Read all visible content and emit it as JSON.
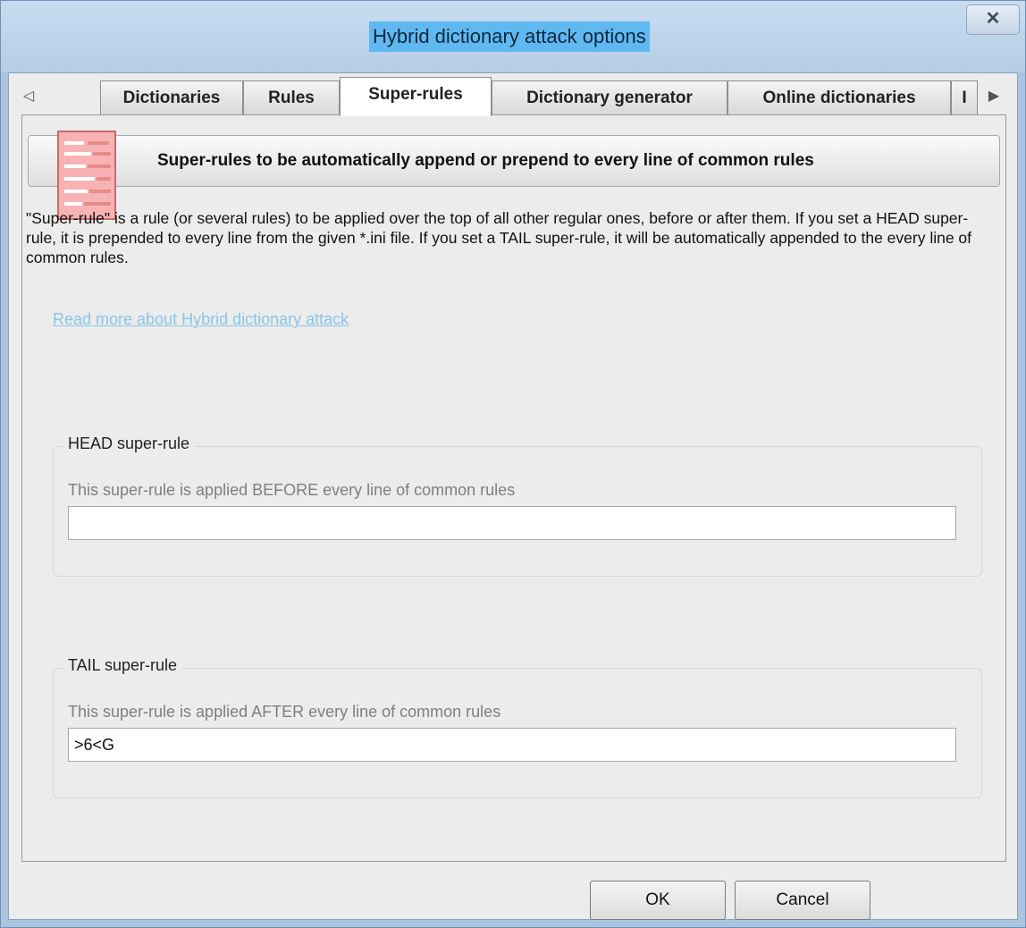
{
  "window": {
    "title": "Hybrid dictionary attack options",
    "close_glyph": "✕"
  },
  "tabs": [
    {
      "label": "Dictionaries"
    },
    {
      "label": "Rules"
    },
    {
      "label": "Super-rules",
      "active": true
    },
    {
      "label": "Dictionary generator"
    },
    {
      "label": "Online dictionaries"
    },
    {
      "label": "I"
    }
  ],
  "tab_nav": {
    "left_glyph": "◁",
    "right_glyph": "▶"
  },
  "header": {
    "title": "Super-rules to be automatically append or prepend to every line of common rules"
  },
  "description": "\"Super-rule\" is a rule (or several rules) to be applied over the top of all other regular ones, before or after them. If you set a HEAD super-rule, it is prepended to every line from the given *.ini file. If you set a TAIL super-rule, it will be automatically appended to the every line of common rules.",
  "link": "Read more about Hybrid dictionary attack",
  "head_group": {
    "title": "HEAD super-rule",
    "hint": "This super-rule is applied BEFORE every line of common rules",
    "value": ""
  },
  "tail_group": {
    "title": "TAIL super-rule",
    "hint": "This super-rule is applied AFTER every line of common rules",
    "value": ">6<G"
  },
  "buttons": {
    "ok": "OK",
    "cancel": "Cancel"
  },
  "colors": {
    "title_highlight": "#5fb9f0",
    "link": "#8ac6e6",
    "logo": "#f7b3b3"
  }
}
